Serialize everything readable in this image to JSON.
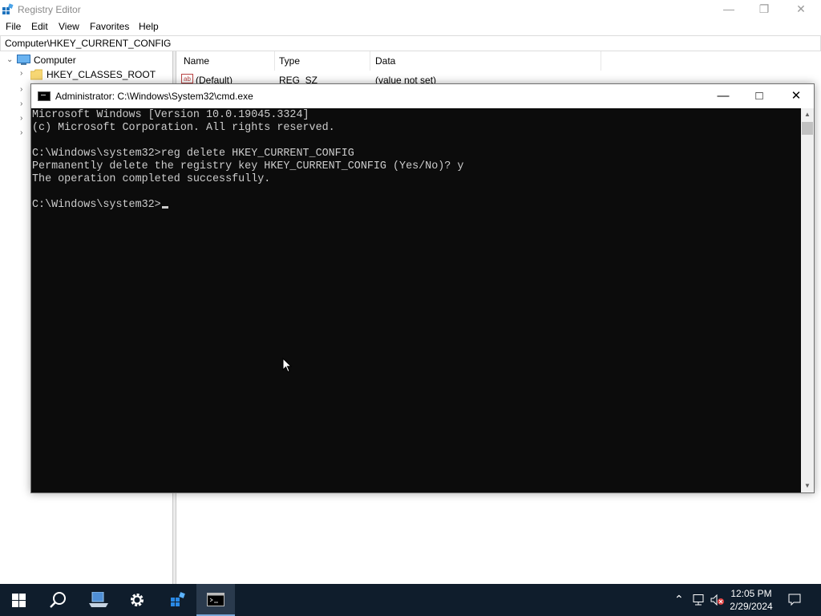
{
  "regedit": {
    "title": "Registry Editor",
    "menu": [
      "File",
      "Edit",
      "View",
      "Favorites",
      "Help"
    ],
    "address": "Computer\\HKEY_CURRENT_CONFIG",
    "tree": {
      "root": "Computer",
      "first_child": "HKEY_CLASSES_ROOT"
    },
    "columns": [
      "Name",
      "Type",
      "Data"
    ],
    "rows": [
      {
        "name": "(Default)",
        "type": "REG_SZ",
        "data": "(value not set)"
      }
    ]
  },
  "cmd": {
    "title": "Administrator: C:\\Windows\\System32\\cmd.exe",
    "lines": [
      "Microsoft Windows [Version 10.0.19045.3324]",
      "(c) Microsoft Corporation. All rights reserved.",
      "",
      "C:\\Windows\\system32>reg delete HKEY_CURRENT_CONFIG",
      "Permanently delete the registry key HKEY_CURRENT_CONFIG (Yes/No)? y",
      "The operation completed successfully.",
      "",
      "C:\\Windows\\system32>"
    ]
  },
  "taskbar": {
    "time": "12:05 PM",
    "date": "2/29/2024",
    "icons": [
      "windows-start-icon",
      "search-icon",
      "network-computer-icon",
      "settings-gear-icon",
      "registry-editor-icon",
      "command-prompt-icon"
    ]
  },
  "colors": {
    "console_bg": "#0c0c0c",
    "console_text": "#cccccc",
    "taskbar_bg": "#0f1d2c"
  }
}
